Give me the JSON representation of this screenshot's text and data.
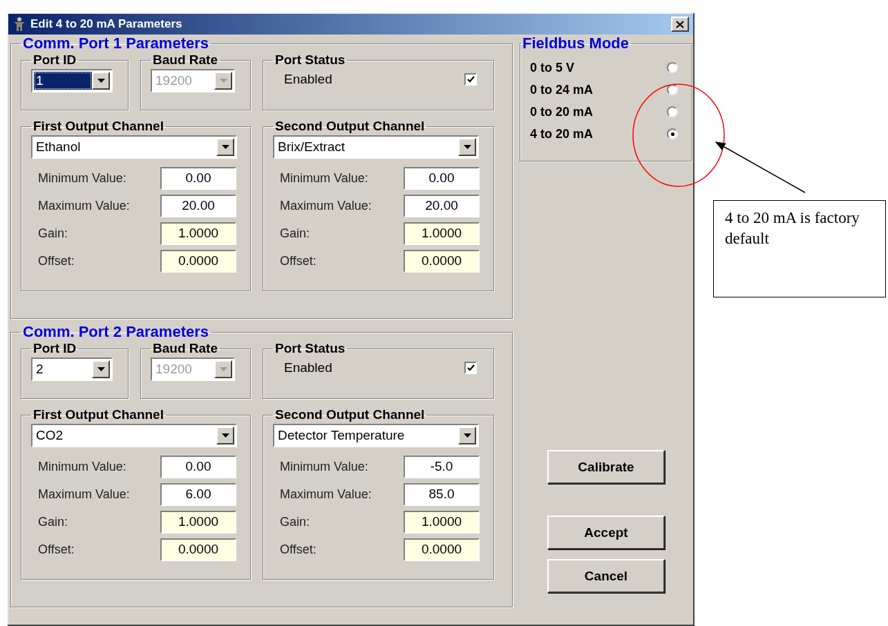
{
  "window": {
    "title": "Edit 4 to 20 mA Parameters"
  },
  "ports": [
    {
      "title": "Comm. Port 1 Parameters",
      "port_id": {
        "label": "Port ID",
        "value": "1",
        "focused": true
      },
      "baud_rate": {
        "label": "Baud Rate",
        "value": "19200",
        "disabled": true
      },
      "port_status": {
        "label": "Port Status",
        "option": "Enabled",
        "checked": true
      },
      "channels": [
        {
          "title": "First Output Channel",
          "selection": "Ethanol",
          "fields": [
            {
              "label": "Minimum Value:",
              "value": "0.00",
              "kind": "input"
            },
            {
              "label": "Maximum Value:",
              "value": "20.00",
              "kind": "input"
            },
            {
              "label": "Gain:",
              "value": "1.0000",
              "kind": "readout"
            },
            {
              "label": "Offset:",
              "value": "0.0000",
              "kind": "readout"
            }
          ]
        },
        {
          "title": "Second Output Channel",
          "selection": "Brix/Extract",
          "fields": [
            {
              "label": "Minimum Value:",
              "value": "0.00",
              "kind": "input"
            },
            {
              "label": "Maximum Value:",
              "value": "20.00",
              "kind": "input"
            },
            {
              "label": "Gain:",
              "value": "1.0000",
              "kind": "readout"
            },
            {
              "label": "Offset:",
              "value": "0.0000",
              "kind": "readout"
            }
          ]
        }
      ]
    },
    {
      "title": "Comm. Port 2 Parameters",
      "port_id": {
        "label": "Port ID",
        "value": "2",
        "focused": false
      },
      "baud_rate": {
        "label": "Baud Rate",
        "value": "19200",
        "disabled": true
      },
      "port_status": {
        "label": "Port Status",
        "option": "Enabled",
        "checked": true
      },
      "channels": [
        {
          "title": "First Output Channel",
          "selection": "CO2",
          "fields": [
            {
              "label": "Minimum Value:",
              "value": "0.00",
              "kind": "input"
            },
            {
              "label": "Maximum Value:",
              "value": "6.00",
              "kind": "input"
            },
            {
              "label": "Gain:",
              "value": "1.0000",
              "kind": "readout"
            },
            {
              "label": "Offset:",
              "value": "0.0000",
              "kind": "readout"
            }
          ]
        },
        {
          "title": "Second Output Channel",
          "selection": "Detector Temperature",
          "fields": [
            {
              "label": "Minimum Value:",
              "value": "-5.0",
              "kind": "input"
            },
            {
              "label": "Maximum Value:",
              "value": "85.0",
              "kind": "input"
            },
            {
              "label": "Gain:",
              "value": "1.0000",
              "kind": "readout"
            },
            {
              "label": "Offset:",
              "value": "0.0000",
              "kind": "readout"
            }
          ]
        }
      ]
    }
  ],
  "fieldbus": {
    "title": "Fieldbus Mode",
    "options": [
      {
        "label": "0 to 5 V",
        "selected": false
      },
      {
        "label": "0 to 24 mA",
        "selected": false
      },
      {
        "label": "0 to 20 mA",
        "selected": false
      },
      {
        "label": "4 to 20 mA",
        "selected": true
      }
    ]
  },
  "buttons": [
    {
      "label": "Calibrate"
    },
    {
      "label": "Accept"
    },
    {
      "label": "Cancel"
    }
  ],
  "annotation": {
    "text": "4 to 20 mA is factory default"
  }
}
